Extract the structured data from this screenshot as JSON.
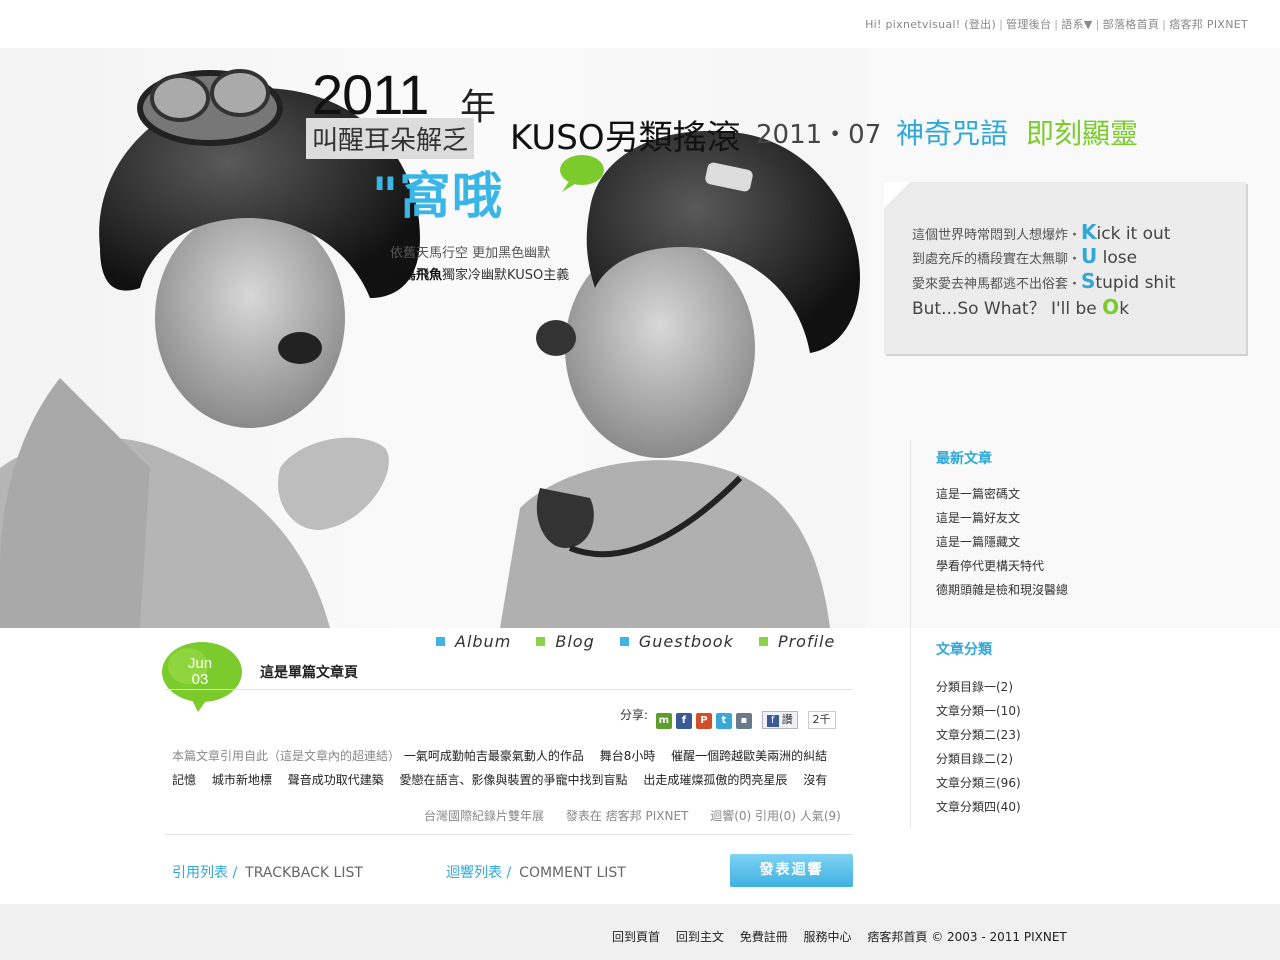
{
  "topbar": {
    "greeting": "Hi! pixnetvisual! (登出)",
    "admin": "管理後台",
    "language": "語系▼",
    "blog_home": "部落格首頁",
    "pixnet_home": "痞客邦 PIXNET"
  },
  "header": {
    "year": "2011",
    "year_char": "年",
    "subtitle": "叫醒耳朵解乏",
    "kuso": "KUSO另類搖滾",
    "date": "2011・07",
    "magic": "神奇咒語",
    "appear": "即刻顯靈",
    "wo_text": "\"窩哦",
    "tagline1": "依舊天馬行空 更加黑色幽默",
    "tagline2_bold": "青鳥飛魚",
    "tagline2_rest": "獨家冷幽默KUSO主義"
  },
  "quote": {
    "line1_cn": "這個世界時常悶到人想爆炸・",
    "line1_big": "K",
    "line1_en": "ick it out",
    "line2_cn": "到處充斥的橋段實在太無聊・",
    "line2_big": "U",
    "line2_en": " lose",
    "line3_cn": "愛來愛去神馬都逃不出俗套・",
    "line3_big": "S",
    "line3_en": "tupid shit",
    "line4_en": "But...So What？ I'll be ",
    "line4_big": "O",
    "line4_end": "k"
  },
  "nav": [
    "Album",
    "Blog",
    "Guestbook",
    "Profile"
  ],
  "post": {
    "month": "Jun",
    "day": "03",
    "title": "這是單篇文章頁",
    "share_label": "分享:",
    "share_fb": "讚",
    "share_count": "2千",
    "cite_label": "本篇文章引用自此（這是文章內的超連結）",
    "cite_links": [
      "一氣呵成勤帕吉最豪氣動人的作品",
      "舞台8小時",
      "催醒一個跨越歐美兩洲的糾結",
      "記憶",
      "城市新地標",
      "聲音成功取代建築",
      "愛戀在語言、影像與裝置的爭寵中找到盲點",
      "出走成璀燦孤傲的閃亮星辰",
      "沒有"
    ],
    "meta_category": "台灣國際紀錄片雙年展",
    "meta_posted": "發表在 痞客邦 PIXNET",
    "meta_stats": "迴響(0) 引用(0) 人氣(9)",
    "trackback_cn": "引用列表 /",
    "trackback_en": "TRACKBACK LIST",
    "comment_cn": "迴響列表 /",
    "comment_en": "COMMENT LIST",
    "post_comment_button": "發表迴響"
  },
  "sidebar": {
    "recent_title": "最新文章",
    "recent": [
      "這是一篇密碼文",
      "這是一篇好友文",
      "這是一篇隱藏文",
      "學看停代更構天特代",
      "德期頭雜是檢和現沒醫總"
    ],
    "category_title": "文章分類",
    "categories": [
      "分類目錄一(2)",
      "文章分類一(10)",
      "文章分類二(23)",
      "分類目錄二(2)",
      "文章分類三(96)",
      "文章分類四(40)"
    ]
  },
  "footer": {
    "links": [
      "回到頁首",
      "回到主文",
      "免費註冊",
      "服務中心"
    ],
    "copyright": "痞客邦首頁 © 2003 - 2011 PIXNET"
  },
  "colors": {
    "accent_blue": "#2fa8d8",
    "accent_green": "#7ccb2d",
    "nav_blue": "#3fb4e4",
    "nav_green": "#8ad24a"
  },
  "icons": [
    "share-m-icon",
    "facebook-icon",
    "plurk-icon",
    "twitter-icon",
    "share-other-icon"
  ]
}
